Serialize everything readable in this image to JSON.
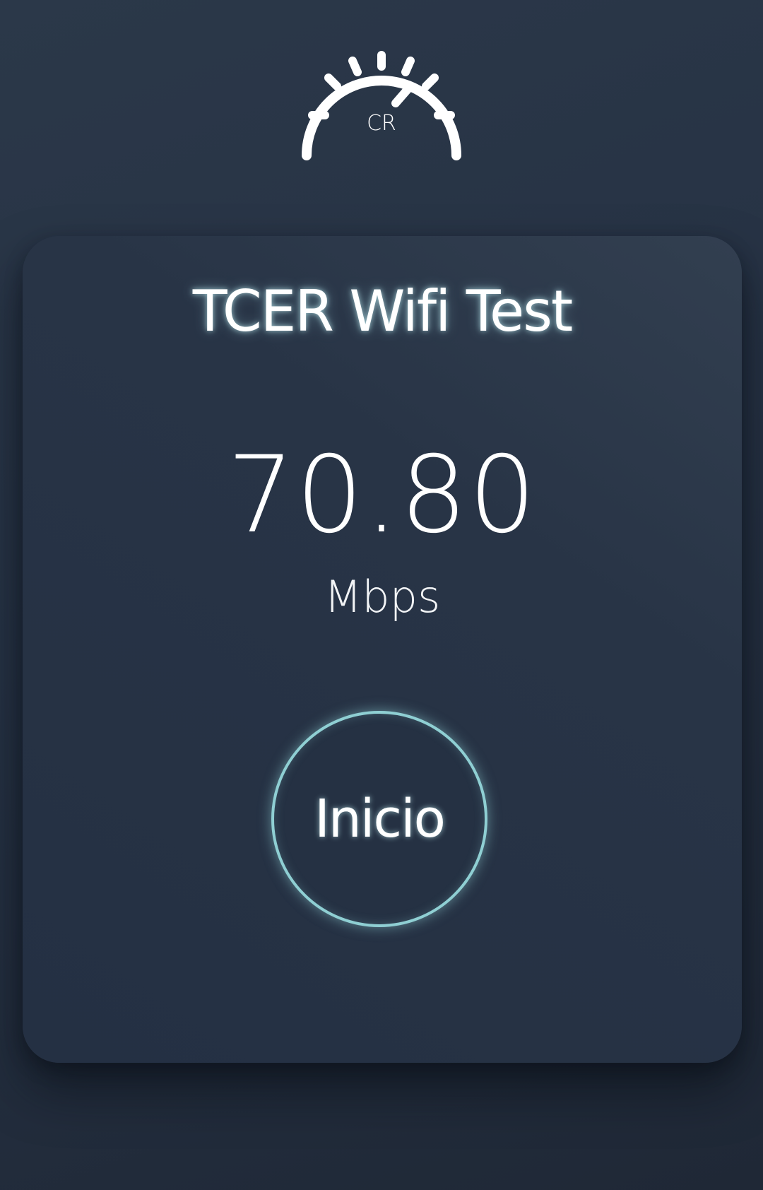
{
  "logo": {
    "icon": "speedometer-icon",
    "monogram": "CR"
  },
  "card": {
    "title": "TCER Wifi Test",
    "speed_value": "70.80",
    "speed_unit": "Mbps",
    "start_button_label": "Inicio"
  },
  "colors": {
    "background": "#263244",
    "card": "#283446",
    "accent_ring": "#8fcfd3",
    "text": "#ffffff"
  }
}
